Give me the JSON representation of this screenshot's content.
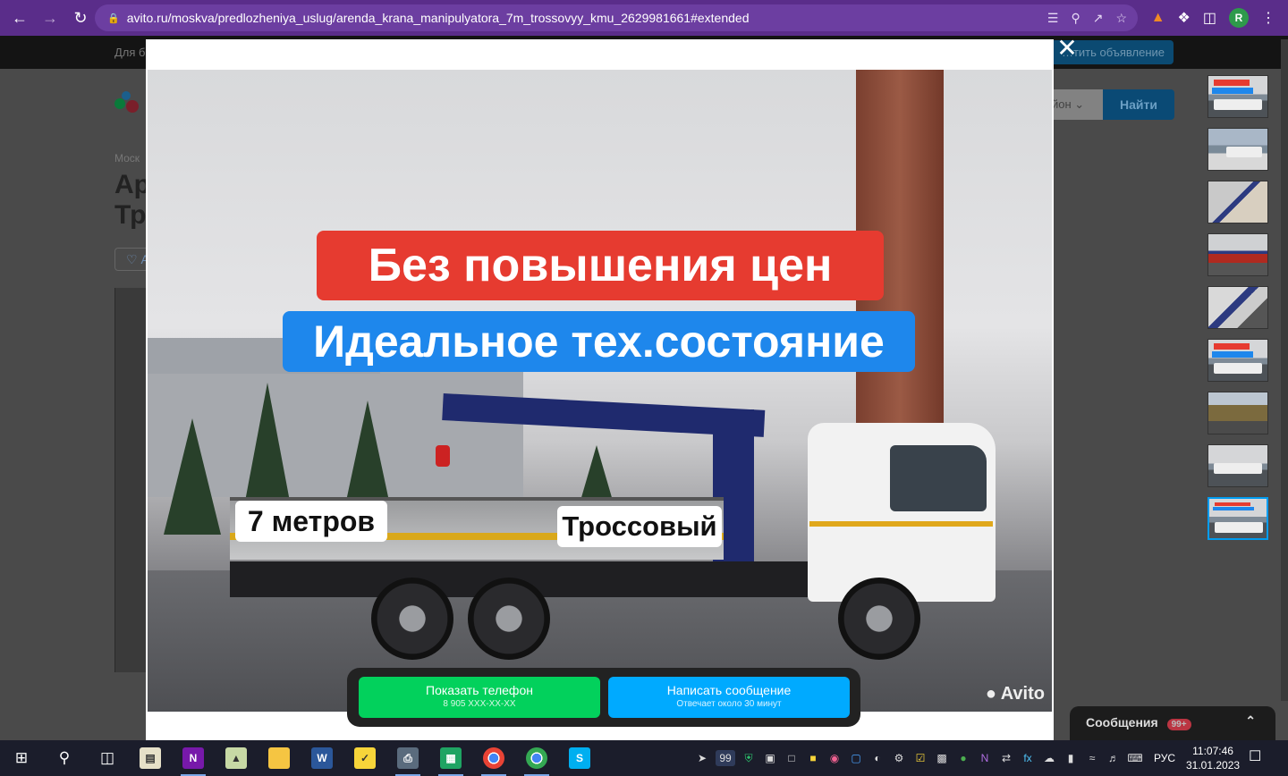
{
  "browser": {
    "url": "avito.ru/moskva/predlozheniya_uslug/arenda_krana_manipulyatora_7m_trossovyy_kmu_2629981661#extended",
    "profile_initial": "R"
  },
  "site": {
    "for_business": "Для б",
    "post_ad": "…тить объявление",
    "region_select": "йон",
    "find_button": "Найти",
    "breadcrumb": "Моск",
    "title_line1": "Ар",
    "title_line2": "Тр",
    "favorite_label": "♡ А"
  },
  "photo": {
    "banner_red": "Без повышения цен",
    "banner_blue": "Идеальное тех.состояние",
    "label_length": "7 метров",
    "label_type": "Троссовый",
    "watermark": "Avito"
  },
  "cta": {
    "phone_label": "Показать телефон",
    "phone_number": "8 905 XXX-XX-XX",
    "message_label": "Написать сообщение",
    "message_sub": "Отвечает около 30 минут"
  },
  "thumbnails": {
    "count": 9,
    "active_index": 8
  },
  "messages": {
    "label": "Сообщения",
    "badge": "99+"
  },
  "taskbar": {
    "tray_badge": "99",
    "language": "РУС",
    "time": "11:07:46",
    "date": "31.01.2023"
  },
  "colors": {
    "chrome": "#5a2d8a",
    "banner_red": "#e63b30",
    "banner_blue": "#1e87ec",
    "cta_green": "#02d15c",
    "cta_blue": "#00aaff",
    "thumb_active": "#009cf0"
  }
}
